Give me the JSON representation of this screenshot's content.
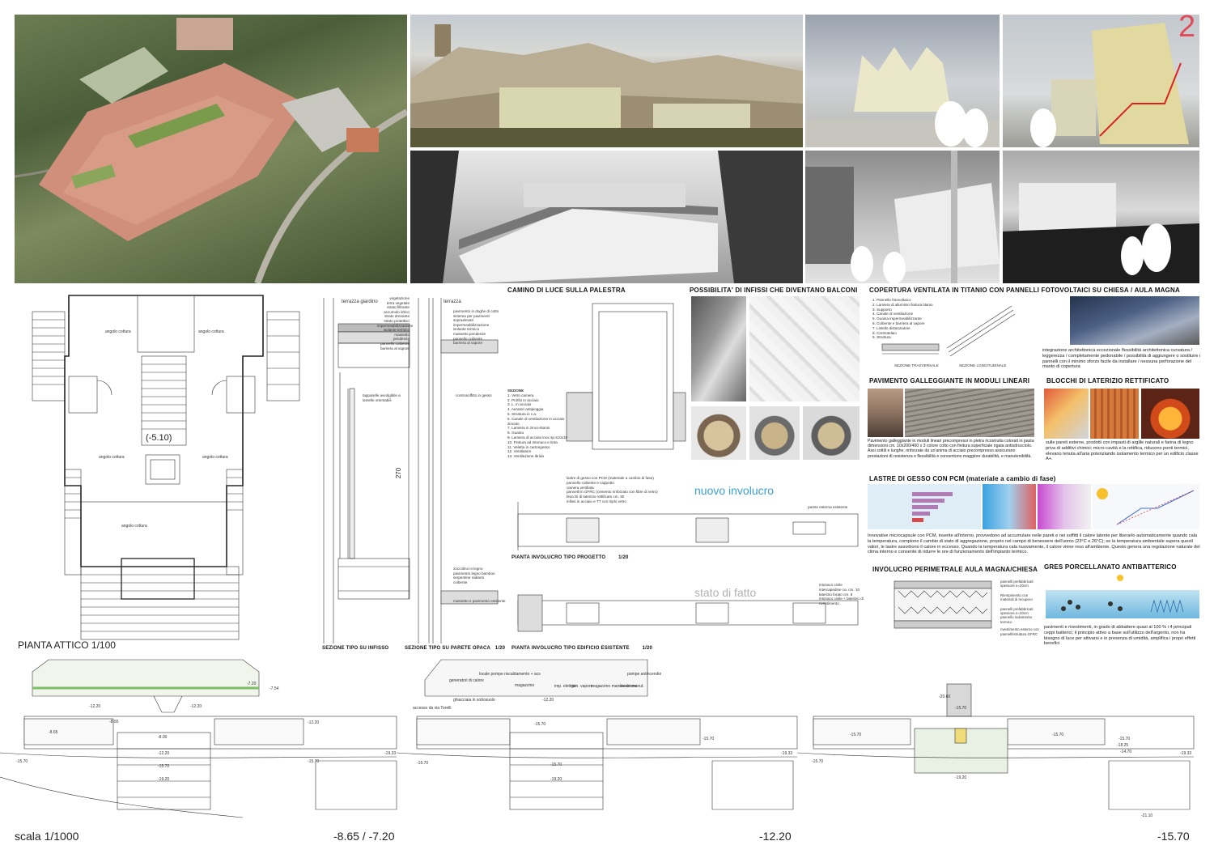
{
  "sheet_number": "2",
  "floorplan": {
    "title": "PIANTA ATTICO  1/100",
    "level": "(-5.10)",
    "rooms": [
      "angolo cottura",
      "angolo cottura",
      "angolo cottura",
      "angolo cottura",
      "angolo cottura"
    ]
  },
  "sections": {
    "infisso": {
      "title": "SEZIONE TIPO SU INFISSO",
      "labels": [
        "terrazza giardino",
        "vegetazione",
        "terra vegetale",
        "strato filtrante",
        "accumulo idrico",
        "strato drenante",
        "strato protettivo",
        "impermeabilizzazione",
        "isolante termico",
        "massetto pendenze",
        "pannello coibente",
        "barriera al vapore",
        "tapparelle avvolgibile a lamelle orientabili"
      ]
    },
    "parete": {
      "title": "SEZIONE TIPO SU PARETE OPACA",
      "scale": "1/20",
      "labels": [
        "terrazza",
        "pavimento in doghe di cotto",
        "sistema per pavimenti sopraelevati",
        "impermeabilizzazione",
        "isolante termico",
        "massetto pendenze",
        "pannello coibente",
        "barriera al vapore",
        "controsoffitto in gesso",
        "zoccolino in legno",
        "pavimento legno bamboo",
        "serpentine radianti",
        "coibente",
        "massetto e pavimento esistente"
      ],
      "height": "270"
    },
    "camino": {
      "title": "CAMINO DI LUCE SULLA PALESTRA",
      "legend_title": "SEZIONE",
      "legend": [
        "1. Vetro camera",
        "2. Profilo in acciaio",
        "3. L. in acciaio",
        "4. Aeratori antipioggia",
        "5. Struttura in c.a.",
        "6. Canale di ventilazione in acciaio zincato",
        "7. Lamiera in zinco-titanio",
        "8. Guaina",
        "9. Lamiera di acciaio inox sp.s10x10",
        "10. Finitura ad intonaco e tinta",
        "11. Veletta in cartongesso",
        "12. Ventilatore",
        "13. Ventilazione ibrida"
      ]
    }
  },
  "infissi": {
    "title": "POSSIBILITA' DI INFISSI CHE DIVENTANO BALCONI"
  },
  "involucro": {
    "nuovo": "nuovo involucro",
    "stato": "stato di fatto",
    "progetto_title": "PIANTA INVOLUCRO TIPO PROGETTO",
    "progetto_scale": "1/20",
    "esistente_title": "PIANTA INVOLUCRO TIPO EDIFICIO ESISTENTE",
    "esistente_scale": "1/20",
    "labels": [
      "lastre di gesso con PCM (materiale a cambio di fase)",
      "pannello coibente e cappotto",
      "camera ventilata",
      "pannelli in GFRC (cemento rinforzato con fibre di vetro)",
      "blocchi di laterizio rettificato cm. 30",
      "infissi in acciaio e TT con triplo vetro",
      "parete esterna esistente",
      "intonaco civile",
      "intercapedine ca. cm. 10",
      "laterizio forato cm. 8",
      "intonaco civile + laterizio di rivestimento"
    ]
  },
  "copertura": {
    "title": "COPERTURA VENTILATA IN TITANIO CON PANNELLI FOTOVOLTAICI SU CHIESA / AULA MAGNA",
    "legend": [
      "1. Pannello fotovoltaico",
      "2. Lamiera di alluminio finitura titanio",
      "3. Supporto",
      "4. Canale di ventilazione",
      "5. Guaina impermeabilizzante",
      "6. Coibente e barriera al vapore",
      "7. Listello distanziatore",
      "8. Controtelaio",
      "9. Struttura"
    ],
    "sez_trasv": "SEZIONE TRASVERSALE",
    "sez_long": "SEZIONE LONGITUDINALE",
    "text": "integrazione architettonica eccezionale flessibilità architettonica curvatura / leggerezza / completamente pedonabile / possibilità di aggiungere o sostituire i pannelli con il minimo sforzo facile da installare / nessuna perforazione del manto di copertura"
  },
  "pavimento": {
    "title": "PAVIMENTO GALLEGGIANTE IN MODULI LINEARI",
    "text": "Pavimento galleggiante in moduli lineari precompressi in pietra ricostruita colorati in pasta dimensioni cm. 10x200/400 x 3 colore cotto con finitura superficiale rigata antisdrucciolo. Assi sottili e lunghe, rinforzate da un'anima di acciaio precompresso assicurano prestazioni di resistenza e flessibilità e consentono maggiore durabilità, e manutenibilità."
  },
  "blocchi": {
    "title": "BLOCCHI DI LATERIZIO RETTIFICATO",
    "text": "sulle pareti esterne, prodotti con impasti di argille naturali e farina di legno priva di additivi chimici; micro-cavità e la rettifica, riducono ponti termici, elevano tenuta all'aria potenziando isolamento termico per un edificio classe A+."
  },
  "lastre": {
    "title": "LASTRE DI GESSO CON PCM (materiale a cambio di fase)",
    "text": "Innovative microcapsule con PCM, inserite all'interno, provvedono ad accumulare nelle pareti e nei soffitti il calore latente per liberarlo automaticamente quando cala la temperatura, compiono il cambio di stato di aggregazione, proprio nel campo di benessere dell'uomo (23°C e 26°C); se la temperatura ambientale supera questi valori, le lastre assorbono il calore in eccesso. Quando la temperatura cala nuovamente, il calore viene reso all'ambiente. Questo genera una regolazione naturale del clima interno e consente di ridurre le ore di funzionamento dell'impianto termico."
  },
  "aula": {
    "title": "INVOLUCRO PERIMETRALE AULA MAGNA/CHIESA",
    "labels": [
      "pannelli prefabbricati spessore e=20cm",
      "Riempimento con materiali di recupero",
      "pannelli prefabbricati spessore e=20cm",
      "pannello isolamento termico",
      "rivestimento esterno con pannelli/struttura GFRC"
    ]
  },
  "gres": {
    "title": "GRES PORCELLANATO ANTIBATTERICO",
    "text": "pavimenti e rivestimenti, in grado di abbattere quasi al 100 % i 4 principali ceppi batterici; il principio attivo a base sull'utilizzo dell'argento, non ha bisogno di luce per attivarsi e in presenza di umidità, amplifica i propri effetti benefici"
  },
  "bottom": {
    "scale": "scala 1/1000",
    "plans": [
      {
        "label": "-8.65 / -7.20",
        "levels": [
          "-7.20",
          "-7.54",
          "-12.20",
          "-8.65",
          "-12.20",
          "-8.00",
          "-12.20",
          "-15.70",
          "-19.20",
          "-12.20",
          "-15.70",
          "-19.33",
          "-15.70",
          "-8.65"
        ]
      },
      {
        "label": "-12.20",
        "levels": [
          "locale pompe riscaldamento + acs",
          "pompe antincendio",
          "magazzino",
          "imp. elettrici",
          "gen. vapore",
          "magazzino manutenzione",
          "locale manut.",
          "generatori di calore",
          "ghiacciaia in sottosuolo",
          "accesso da via Torelli",
          "-12.20",
          "-15.70",
          "-15.70",
          "-19.20",
          "-19.33",
          "-15.70",
          "-15.70"
        ]
      },
      {
        "label": "-15.70",
        "levels": [
          "-20.60",
          "-15.70",
          "-15.70",
          "-15.70",
          "-19.20",
          "-18.25",
          "-14.70",
          "-15.70",
          "-19.33",
          "-21.10",
          "-15.70"
        ]
      }
    ]
  }
}
